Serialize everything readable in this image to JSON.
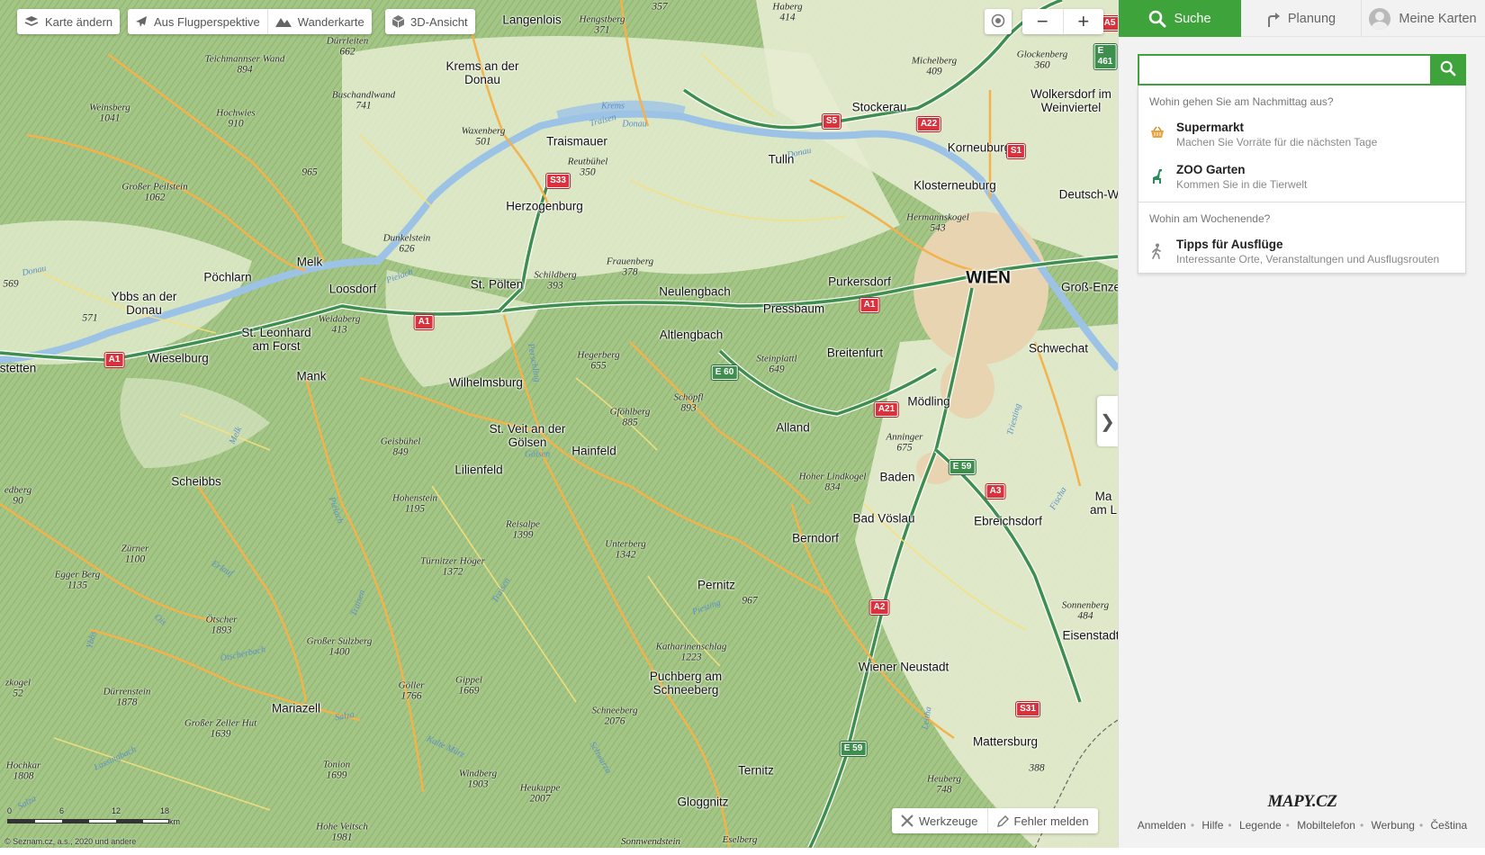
{
  "map": {
    "toolbar": {
      "change_map": "Karte ändern",
      "aerial": "Aus Flugperspektive",
      "hiking": "Wanderkarte",
      "view3d": "3D-Ansicht"
    },
    "zoom_out": "−",
    "zoom_in": "+",
    "panel_toggle": "❯",
    "tools": "Werkzeuge",
    "report_error": "Fehler melden",
    "scale_ticks": [
      "0",
      "6",
      "12",
      "18",
      "km"
    ],
    "copyright": "© Seznam.cz, a.s., 2020 und andere",
    "capital": "WIEN",
    "towns": [
      "Langenlois",
      "Krems an der Donau",
      "Stockerau",
      "Wolkersdorf im Weinviertel",
      "Traismauer",
      "Tulln",
      "Korneuburg",
      "Herzogenburg",
      "Klosterneuburg",
      "Deutsch-W",
      "Melk",
      "Pöchlarn",
      "Loosdorf",
      "St. Pölten",
      "Neulengbach",
      "Purkersdorf",
      "Groß-Enze",
      "Ybbs an der Donau",
      "Pressbaum",
      "St. Leonhard am Forst",
      "Wieselburg",
      "Altlengbach",
      "Breitenfurt",
      "Schwechat",
      "stetten",
      "Mank",
      "Wilhelmsburg",
      "Mödling",
      "St. Veit an der Gölsen",
      "Alland",
      "Hainfeld",
      "Lilienfeld",
      "Baden",
      "Scheibbs",
      "Ma am L",
      "Bad Vöslau",
      "Ebreichsdorf",
      "Berndorf",
      "Pernitz",
      "Eisenstadt",
      "Wiener Neustadt",
      "Puchberg am Schneeberg",
      "Mariazell",
      "Mattersburg",
      "Ternitz",
      "Gloggnitz"
    ],
    "peaks": [
      {
        "name": "Hengstberg",
        "elev": "371"
      },
      {
        "name": "Haberg",
        "elev": "414"
      },
      {
        "name": "Dürrleiten",
        "elev": "662"
      },
      {
        "name": "Teichmannser Wand",
        "elev": "894"
      },
      {
        "name": "Michelberg",
        "elev": "409"
      },
      {
        "name": "Glockenberg",
        "elev": "360"
      },
      {
        "name": "Weinsberg",
        "elev": "1041"
      },
      {
        "name": "Buschandlwand",
        "elev": "741"
      },
      {
        "name": "Hochwies",
        "elev": "910"
      },
      {
        "name": "Waxenberg",
        "elev": "501"
      },
      {
        "name": "Reutbühel",
        "elev": "350"
      },
      {
        "name": "",
        "elev": "965"
      },
      {
        "name": "Großer Peilstein",
        "elev": "1062"
      },
      {
        "name": "Hermannskogel",
        "elev": "543"
      },
      {
        "name": "Dunkelstein",
        "elev": "626"
      },
      {
        "name": "Frauenberg",
        "elev": "378"
      },
      {
        "name": "",
        "elev": "569"
      },
      {
        "name": "Schildberg",
        "elev": "393"
      },
      {
        "name": "Weidaberg",
        "elev": "413"
      },
      {
        "name": "",
        "elev": "571"
      },
      {
        "name": "Steinplattl",
        "elev": "649"
      },
      {
        "name": "Hegerberg",
        "elev": "655"
      },
      {
        "name": "Schöpfl",
        "elev": "893"
      },
      {
        "name": "Gföhlberg",
        "elev": "885"
      },
      {
        "name": "Anninger",
        "elev": "675"
      },
      {
        "name": "Geisbühel",
        "elev": "849"
      },
      {
        "name": "Hoher Lindkogel",
        "elev": "834"
      },
      {
        "name": "edberg",
        "elev": "90"
      },
      {
        "name": "Hohenstein",
        "elev": "1195"
      },
      {
        "name": "Reisalpe",
        "elev": "1399"
      },
      {
        "name": "Unterberg",
        "elev": "1342"
      },
      {
        "name": "Zürner",
        "elev": "1100"
      },
      {
        "name": "Egger Berg",
        "elev": "1135"
      },
      {
        "name": "Türnitzer Höger",
        "elev": "1372"
      },
      {
        "name": "",
        "elev": "967"
      },
      {
        "name": "Sonnenberg",
        "elev": "484"
      },
      {
        "name": "Ötscher",
        "elev": "1893"
      },
      {
        "name": "Großer Sulzberg",
        "elev": "1400"
      },
      {
        "name": "Katharinenschlag",
        "elev": "1223"
      },
      {
        "name": "zkogel",
        "elev": "52"
      },
      {
        "name": "Dürrenstein",
        "elev": "1878"
      },
      {
        "name": "Göller",
        "elev": "1766"
      },
      {
        "name": "Gippel",
        "elev": "1669"
      },
      {
        "name": "Schneeberg",
        "elev": "2076"
      },
      {
        "name": "Großer Zeller Hut",
        "elev": "1639"
      },
      {
        "name": "Hochkar",
        "elev": "1808"
      },
      {
        "name": "Tonion",
        "elev": "1699"
      },
      {
        "name": "Windberg",
        "elev": "1903"
      },
      {
        "name": "Heukuppe",
        "elev": "2007"
      },
      {
        "name": "Heuberg",
        "elev": "748"
      },
      {
        "name": "",
        "elev": "388"
      },
      {
        "name": "Hohe Veitsch",
        "elev": "1981"
      },
      {
        "name": "Sonnwendstein",
        "elev": ""
      },
      {
        "name": "Eselberg",
        "elev": ""
      },
      {
        "name": "",
        "elev": "357"
      }
    ],
    "rivers": [
      "Donau",
      "Krems",
      "Traisen",
      "Donau",
      "Donau",
      "Pielach",
      "Perschling",
      "Melk",
      "Gölsen",
      "Pielach",
      "Triesting",
      "Fischa",
      "Erlauf",
      "Traisen",
      "Traisen",
      "Ois",
      "Ybbs",
      "Ötscherbach",
      "Salza",
      "Piesting",
      "Kalte Mürz",
      "Schwarza",
      "Leitha",
      "Lassingbach",
      "Salza"
    ],
    "shields": [
      {
        "label": "A5",
        "color": "red"
      },
      {
        "label": "E 461",
        "color": "green"
      },
      {
        "label": "S5",
        "color": "red"
      },
      {
        "label": "A22",
        "color": "red"
      },
      {
        "label": "S1",
        "color": "red"
      },
      {
        "label": "S33",
        "color": "red"
      },
      {
        "label": "A1",
        "color": "red"
      },
      {
        "label": "A1",
        "color": "red"
      },
      {
        "label": "A1",
        "color": "red"
      },
      {
        "label": "E 60",
        "color": "green"
      },
      {
        "label": "A21",
        "color": "red"
      },
      {
        "label": "E 59",
        "color": "green"
      },
      {
        "label": "A3",
        "color": "red"
      },
      {
        "label": "A2",
        "color": "red"
      },
      {
        "label": "S31",
        "color": "red"
      },
      {
        "label": "E 59",
        "color": "green"
      }
    ]
  },
  "panel": {
    "tabs": {
      "search": "Suche",
      "plan": "Planung",
      "maps": "Meine Karten"
    },
    "search": {
      "value": "",
      "placeholder": ""
    },
    "groups": [
      {
        "title": "Wohin gehen Sie am Nachmittag aus?",
        "items": [
          {
            "icon": "basket-icon",
            "title": "Supermarkt",
            "subtitle": "Machen Sie Vorräte für die nächsten Tage"
          },
          {
            "icon": "giraffe-icon",
            "title": "ZOO Garten",
            "subtitle": "Kommen Sie in die Tierwelt"
          }
        ]
      },
      {
        "title": "Wohin am Wochenende?",
        "items": [
          {
            "icon": "hiker-icon",
            "title": "Tipps für Ausflüge",
            "subtitle": "Interessante Orte, Veranstaltungen und Ausflugsrouten"
          }
        ]
      }
    ],
    "logo": "MAPY.CZ",
    "footer_links": [
      "Anmelden",
      "Hilfe",
      "Legende",
      "Mobiltelefon",
      "Werbung",
      "Čeština"
    ]
  },
  "colors": {
    "accent": "#3ea33a",
    "motorway": "#3e8e4e",
    "highway_shield": "#d9323c",
    "forest": "#a7c98a",
    "urban": "#e6d8b8",
    "water": "#9cc3e6"
  }
}
